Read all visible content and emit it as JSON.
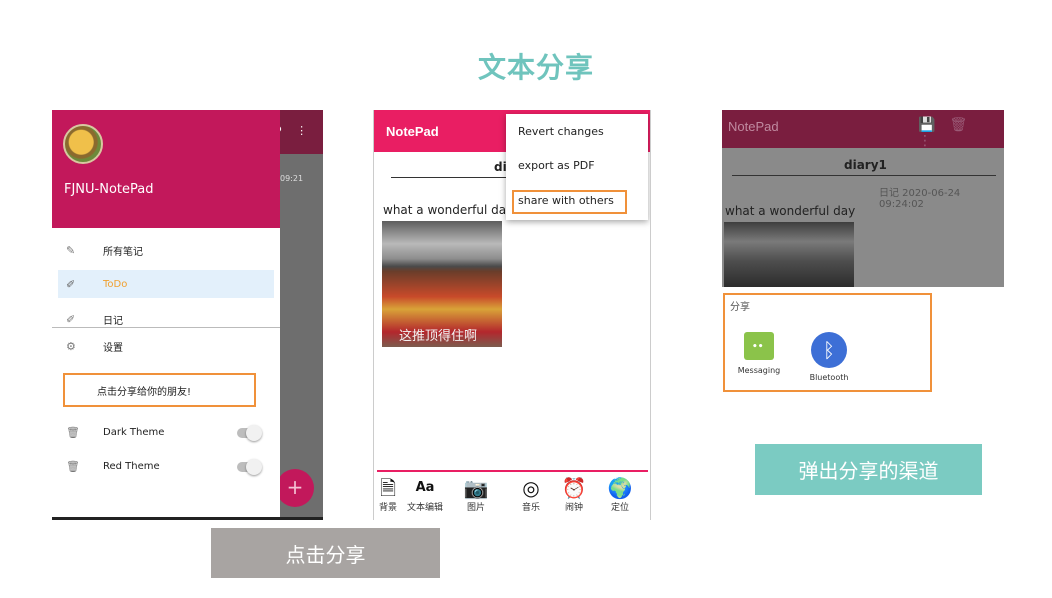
{
  "slide": {
    "title": "文本分享"
  },
  "drawer_panel": {
    "user_name": "FJNU-NotePad",
    "items": [
      {
        "label": "所有笔记",
        "icon": "edit-note-icon"
      },
      {
        "label": "ToDo",
        "icon": "pencil-icon",
        "selected": true
      },
      {
        "label": "日记",
        "icon": "pencil-icon"
      },
      {
        "label": "设置",
        "icon": "gear-icon"
      }
    ],
    "share_label": "点击分享给你的朋友!",
    "theme_items": [
      {
        "label": "Dark Theme",
        "icon": "trash-icon",
        "on": false
      },
      {
        "label": "Red Theme",
        "icon": "trash-icon",
        "on": false
      }
    ],
    "background_time": "09:21",
    "fab_label": "+"
  },
  "editor_panel": {
    "app_title": "NotePad",
    "doc_title": "di",
    "body_text": "what a  wonderful day",
    "image_caption": "这推顶得住啊",
    "menu": [
      "Revert changes",
      "export as PDF",
      "share with others"
    ],
    "toolbar": [
      {
        "label": "背景",
        "icon": "document-icon"
      },
      {
        "label": "文本编辑",
        "icon": "font-icon",
        "glyph": "Aa"
      },
      {
        "label": "图片",
        "icon": "camera-icon"
      },
      {
        "label": "音乐",
        "icon": "disc-icon"
      },
      {
        "label": "闹钟",
        "icon": "alarm-clock-icon"
      },
      {
        "label": "定位",
        "icon": "globe-icon"
      }
    ]
  },
  "share_panel": {
    "app_title": "NotePad",
    "doc_title": "diary1",
    "date": "日记 2020-06-24 09:24:02",
    "body_text": "what a  wonderful day",
    "sheet_label": "分享",
    "apps": [
      {
        "label": "Messaging",
        "icon": "messaging-icon"
      },
      {
        "label": "Bluetooth",
        "icon": "bluetooth-icon"
      }
    ]
  },
  "captions": {
    "click_share": "点击分享",
    "popup_channels": "弹出分享的渠道"
  },
  "colors": {
    "accent_teal": "#6fc4bd",
    "highlight_orange": "#f0913a",
    "primary_pink": "#e91e63",
    "drawer_header": "#c2185b"
  }
}
